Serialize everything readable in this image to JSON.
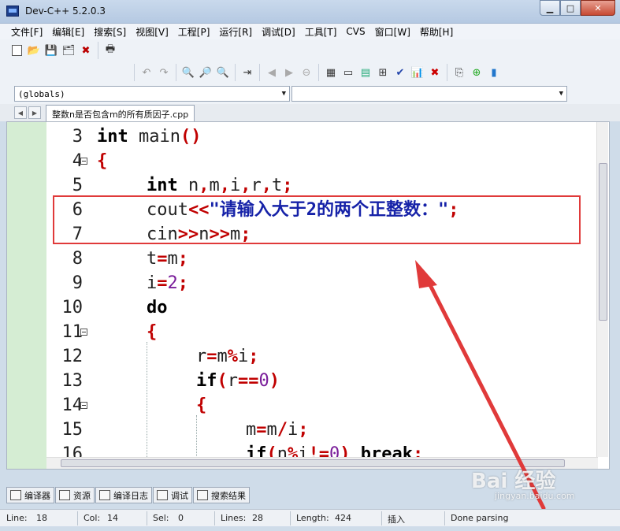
{
  "window": {
    "title": "Dev-C++ 5.2.0.3"
  },
  "menu": [
    "文件[F]",
    "编辑[E]",
    "搜索[S]",
    "视图[V]",
    "工程[P]",
    "运行[R]",
    "调试[D]",
    "工具[T]",
    "CVS",
    "窗口[W]",
    "帮助[H]"
  ],
  "combo": {
    "scope": "(globals)",
    "symbol": ""
  },
  "file_tab": "整数n是否包含m的所有质因子.cpp",
  "code_lines": [
    {
      "n": "3",
      "fold": false,
      "indent": 0,
      "tokens": [
        [
          "kw",
          "int"
        ],
        [
          "t",
          " main"
        ],
        [
          "op",
          "()"
        ]
      ]
    },
    {
      "n": "4",
      "fold": true,
      "indent": 0,
      "tokens": [
        [
          "op",
          "{"
        ]
      ]
    },
    {
      "n": "5",
      "fold": false,
      "indent": 1,
      "tokens": [
        [
          "kw",
          "int"
        ],
        [
          "t",
          " n"
        ],
        [
          "op",
          ","
        ],
        [
          "t",
          "m"
        ],
        [
          "op",
          ","
        ],
        [
          "t",
          "i"
        ],
        [
          "op",
          ","
        ],
        [
          "t",
          "r"
        ],
        [
          "op",
          ","
        ],
        [
          "t",
          "t"
        ],
        [
          "op",
          ";"
        ]
      ]
    },
    {
      "n": "6",
      "fold": false,
      "indent": 1,
      "tokens": [
        [
          "t",
          "cout"
        ],
        [
          "op",
          "<<"
        ],
        [
          "str",
          "\"请输入大于2的两个正整数：\""
        ],
        [
          "op",
          ";"
        ]
      ]
    },
    {
      "n": "7",
      "fold": false,
      "indent": 1,
      "tokens": [
        [
          "t",
          "cin"
        ],
        [
          "op",
          ">>"
        ],
        [
          "t",
          "n"
        ],
        [
          "op",
          ">>"
        ],
        [
          "t",
          "m"
        ],
        [
          "op",
          ";"
        ]
      ]
    },
    {
      "n": "8",
      "fold": false,
      "indent": 1,
      "tokens": [
        [
          "t",
          "t"
        ],
        [
          "op",
          "="
        ],
        [
          "t",
          "m"
        ],
        [
          "op",
          ";"
        ]
      ]
    },
    {
      "n": "9",
      "fold": false,
      "indent": 1,
      "tokens": [
        [
          "t",
          "i"
        ],
        [
          "op",
          "="
        ],
        [
          "num",
          "2"
        ],
        [
          "op",
          ";"
        ]
      ]
    },
    {
      "n": "10",
      "fold": false,
      "indent": 1,
      "tokens": [
        [
          "kw",
          "do"
        ]
      ]
    },
    {
      "n": "11",
      "fold": true,
      "indent": 1,
      "tokens": [
        [
          "op",
          "{"
        ]
      ]
    },
    {
      "n": "12",
      "fold": false,
      "indent": 2,
      "tokens": [
        [
          "t",
          "r"
        ],
        [
          "op",
          "="
        ],
        [
          "t",
          "m"
        ],
        [
          "op",
          "%"
        ],
        [
          "t",
          "i"
        ],
        [
          "op",
          ";"
        ]
      ]
    },
    {
      "n": "13",
      "fold": false,
      "indent": 2,
      "tokens": [
        [
          "kw",
          "if"
        ],
        [
          "op",
          "("
        ],
        [
          "t",
          "r"
        ],
        [
          "op",
          "=="
        ],
        [
          "num",
          "0"
        ],
        [
          "op",
          ")"
        ]
      ]
    },
    {
      "n": "14",
      "fold": true,
      "indent": 2,
      "tokens": [
        [
          "op",
          "{"
        ]
      ]
    },
    {
      "n": "15",
      "fold": false,
      "indent": 3,
      "tokens": [
        [
          "t",
          "m"
        ],
        [
          "op",
          "="
        ],
        [
          "t",
          "m"
        ],
        [
          "op",
          "/"
        ],
        [
          "t",
          "i"
        ],
        [
          "op",
          ";"
        ]
      ]
    },
    {
      "n": "16",
      "fold": false,
      "indent": 3,
      "tokens": [
        [
          "kw",
          "if"
        ],
        [
          "op",
          "("
        ],
        [
          "t",
          "n"
        ],
        [
          "op",
          "%"
        ],
        [
          "t",
          "i"
        ],
        [
          "op",
          "!="
        ],
        [
          "num",
          "0"
        ],
        [
          "op",
          ")"
        ],
        [
          "t",
          " "
        ],
        [
          "kw",
          "break"
        ],
        [
          "op",
          ";"
        ]
      ]
    }
  ],
  "bottom_tabs": [
    {
      "label": "编译器",
      "icon": "compiler-icon"
    },
    {
      "label": "资源",
      "icon": "resources-icon"
    },
    {
      "label": "编译日志",
      "icon": "compile-log-icon"
    },
    {
      "label": "调试",
      "icon": "debug-icon"
    },
    {
      "label": "搜索结果",
      "icon": "search-results-icon"
    }
  ],
  "status": {
    "line_label": "Line:",
    "line": "18",
    "col_label": "Col:",
    "col": "14",
    "sel_label": "Sel:",
    "sel": "0",
    "lines_label": "Lines:",
    "lines": "28",
    "length_label": "Length:",
    "length": "424",
    "mode": "插入",
    "state": "Done parsing"
  },
  "watermark": {
    "text": "Bai 经验",
    "sub": "jingyan.baidu.com"
  },
  "colors": {
    "highlight": "#e03a3a",
    "gutter": "#d5edd3",
    "operator": "#c00000",
    "string": "#1622a8"
  }
}
